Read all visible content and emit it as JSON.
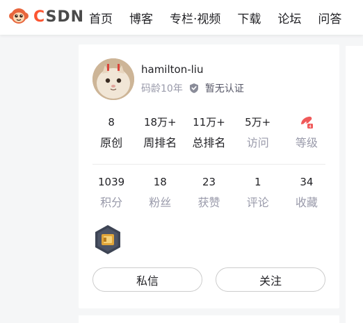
{
  "header": {
    "logo_text": "CSDN",
    "nav": [
      "首页",
      "博客",
      "专栏·视频",
      "下载",
      "论坛",
      "问答"
    ]
  },
  "profile": {
    "username": "hamilton-liu",
    "code_age": "码龄10年",
    "certification": "暂无认证",
    "stats_row1": [
      {
        "value": "8",
        "label": "原创"
      },
      {
        "value": "18万+",
        "label": "周排名"
      },
      {
        "value": "11万+",
        "label": "总排名"
      },
      {
        "value": "5万+",
        "label": "访问"
      },
      {
        "icon": "level-icon",
        "label": "等级"
      }
    ],
    "stats_row2": [
      {
        "value": "1039",
        "label": "积分"
      },
      {
        "value": "18",
        "label": "粉丝"
      },
      {
        "value": "23",
        "label": "获赞"
      },
      {
        "value": "1",
        "label": "评论"
      },
      {
        "value": "34",
        "label": "收藏"
      }
    ],
    "buttons": {
      "message": "私信",
      "follow": "关注"
    }
  },
  "colors": {
    "brand": "#fc5531",
    "text": "#222226",
    "muted": "#999aaa",
    "background": "#f5f6f7"
  }
}
